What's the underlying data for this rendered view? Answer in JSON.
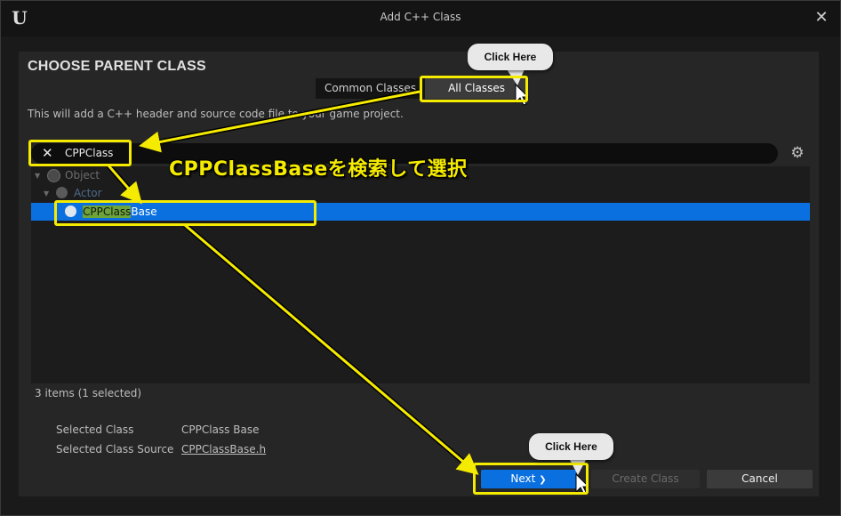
{
  "window": {
    "title": "Add C++ Class",
    "logo": "U",
    "close": "✕"
  },
  "heading": "CHOOSE PARENT CLASS",
  "tabs": {
    "common": "Common Classes",
    "all": "All Classes"
  },
  "description": "This will add a C++ header and source code file to your game project.",
  "search": {
    "value": "CPPClass",
    "clear": "✕"
  },
  "settings_icon": "⚙",
  "tree": {
    "object": "Object",
    "actor": "Actor",
    "selected_highlight": "CPPClass",
    "selected_rest": "Base"
  },
  "status": "3 items (1 selected)",
  "info": {
    "selected_class_label": "Selected Class",
    "selected_class_value": "CPPClass Base",
    "selected_source_label": "Selected Class Source",
    "selected_source_value": "CPPClassBase.h"
  },
  "buttons": {
    "next": "Next",
    "next_glyph": "❯",
    "create": "Create Class",
    "cancel": "Cancel"
  },
  "annotations": {
    "callout1": "Click Here",
    "callout2": "Click Here",
    "instruction": "CPPClassBaseを検索して選択"
  },
  "colors": {
    "accent": "#0a70e0",
    "highlight": "#f5eb00",
    "match": "#6da53a"
  }
}
